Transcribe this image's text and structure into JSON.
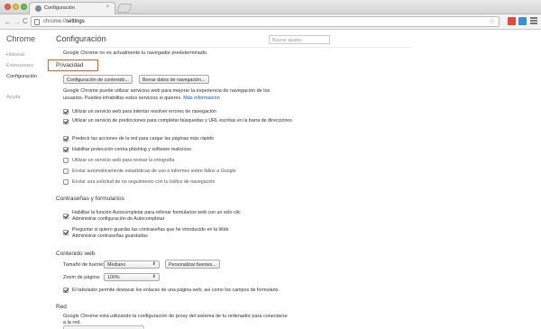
{
  "browser": {
    "tab_title": "Configuración",
    "tab_close": "×",
    "url_scheme": "chrome://",
    "url_path": "settings",
    "nav_back": "←",
    "nav_forward": "→",
    "nav_reload": "C",
    "star": "☆"
  },
  "sidebar": {
    "title": "Chrome",
    "items": [
      {
        "label": "Historial"
      },
      {
        "label": "Extensiones"
      },
      {
        "label": "Configuración"
      },
      {
        "label": "Ayuda"
      }
    ]
  },
  "header": {
    "title": "Configuración",
    "search_placeholder": "Buscar ajustes"
  },
  "default_browser_text": "Google Chrome no es actualmente tu navegador predeterminado.",
  "privacy": {
    "heading": "Privacidad",
    "content_settings_button": "Configuración de contenido...",
    "clear_data_button": "Borrar datos de navegación...",
    "description_line1": "Google Chrome puede utilizar servicios web para mejorar la experiencia de navegación de los",
    "description_line2": "usuarios. Puedes inhabilitar estos servicios si quieres.",
    "more_info": "Más información",
    "options": [
      {
        "label": "Utilizar un servicio web para intentar resolver errores de navegación",
        "checked": true
      },
      {
        "label": "Utilizar un servicio de predicciones para completar búsquedas y URL escritas en la barra de direcciones",
        "checked": true
      },
      {
        "label": "Predecir las acciones de la red para cargar las páginas más rápido",
        "checked": true
      },
      {
        "label": "Habilitar protección contra phishing y software malicioso",
        "checked": true
      },
      {
        "label": "Utilizar un servicio web para revisar la ortografía",
        "checked": false
      },
      {
        "label": "Enviar automáticamente estadísticas de uso e informes sobre fallos a Google",
        "checked": false
      },
      {
        "label": "Enviar una solicitud de no seguimiento con tu tráfico de navegación",
        "checked": false
      }
    ]
  },
  "passwords": {
    "heading": "Contraseñas y formularios",
    "autofill_label": "Habilitar la función Autocompletar para rellenar formularios web con un solo clic",
    "autofill_link": "Administrar configuración de Autocompletar",
    "autofill_checked": true,
    "save_pw_label": "Preguntar si quiero guardar las contraseñas que he introducido en la Web",
    "save_pw_link": "Administrar contraseñas guardadas",
    "save_pw_checked": true
  },
  "web_content": {
    "heading": "Contenido web",
    "font_size_label": "Tamaño de fuente:",
    "font_size_value": "Mediano",
    "customize_fonts_button": "Personalizar fuentes...",
    "zoom_label": "Zoom de página:",
    "zoom_value": "100%",
    "tab_highlight_label": "El tabulador permite destacar los enlaces de una página web, así como los campos de formulario.",
    "tab_highlight_checked": true
  },
  "network": {
    "heading": "Red",
    "description_line1": "Google Chrome está utilizando la configuración de proxy del sistema de tu ordenador para conectarse",
    "description_line2": "a la red."
  },
  "colors": {
    "highlight_border": "#e0622b",
    "link": "#1155cc"
  }
}
